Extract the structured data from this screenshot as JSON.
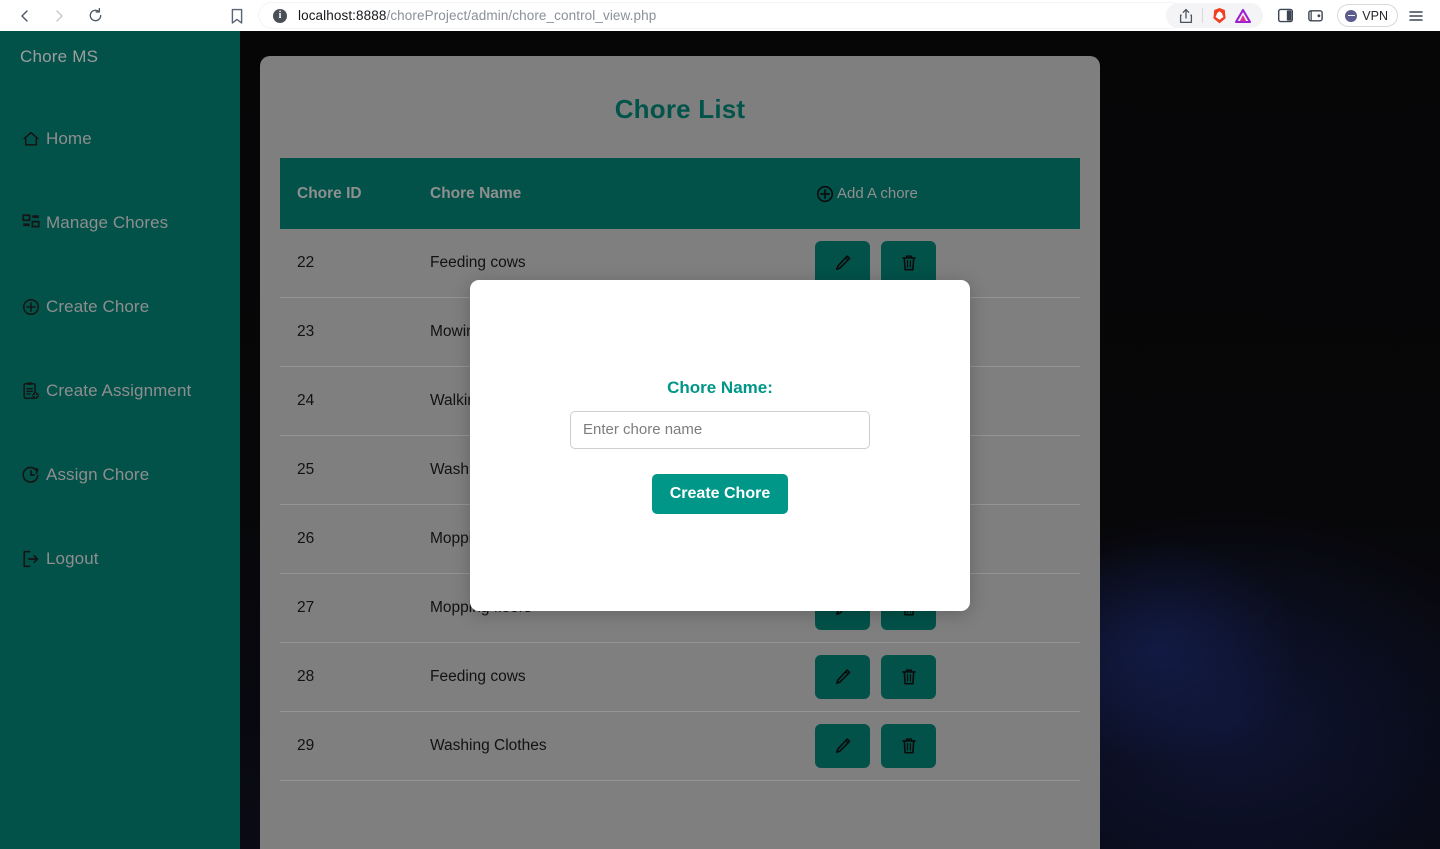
{
  "browser": {
    "back_icon": "chevron-left-icon",
    "forward_icon": "chevron-right-icon",
    "reload_icon": "reload-icon",
    "bookmark_icon": "bookmark-icon",
    "site_info_glyph": "i",
    "url_host": "localhost:8888",
    "url_path": "/choreProject/admin/chore_control_view.php",
    "share_icon": "share-icon",
    "brave_icon": "brave-lion-icon",
    "triangle_icon": "purple-triangle-icon",
    "sidebar_panel_icon": "sidebar-panel-icon",
    "wallet_icon": "wallet-icon",
    "vpn_label": "VPN",
    "menu_icon": "hamburger-menu-icon"
  },
  "sidebar": {
    "brand": "Chore MS",
    "bg_color": "#02524A",
    "text_color": "#8e8e8e",
    "items": [
      {
        "label": "Home",
        "icon": "home-icon"
      },
      {
        "label": "Manage Chores",
        "icon": "grid-dashboard-icon"
      },
      {
        "label": "Create Chore",
        "icon": "plus-circle-icon"
      },
      {
        "label": "Create Assignment",
        "icon": "clipboard-plus-icon"
      },
      {
        "label": "Assign Chore",
        "icon": "clock-arrow-icon"
      },
      {
        "label": "Logout",
        "icon": "logout-arrow-icon"
      }
    ]
  },
  "main": {
    "title": "Chore List",
    "title_color": "#02544A",
    "card_bg": "#7f7f7f",
    "table": {
      "headers": {
        "id": "Chore ID",
        "name": "Chore Name",
        "add_action": "Add A chore",
        "add_icon": "plus-circle-icon"
      },
      "rows": [
        {
          "id": "22",
          "name": "Feeding cows",
          "edit_icon": "pencil-icon",
          "delete_icon": "trash-icon"
        },
        {
          "id": "23",
          "name": "Mowing the lawn",
          "edit_icon": "pencil-icon",
          "delete_icon": "trash-icon"
        },
        {
          "id": "24",
          "name": "Walking the dog",
          "edit_icon": "pencil-icon",
          "delete_icon": "trash-icon"
        },
        {
          "id": "25",
          "name": "Washing dishes",
          "edit_icon": "pencil-icon",
          "delete_icon": "trash-icon"
        },
        {
          "id": "26",
          "name": "Mopping floors",
          "edit_icon": "pencil-icon",
          "delete_icon": "trash-icon"
        },
        {
          "id": "27",
          "name": "Mopping floors",
          "edit_icon": "pencil-icon",
          "delete_icon": "trash-icon"
        },
        {
          "id": "28",
          "name": "Feeding cows",
          "edit_icon": "pencil-icon",
          "delete_icon": "trash-icon"
        },
        {
          "id": "29",
          "name": "Washing Clothes",
          "edit_icon": "pencil-icon",
          "delete_icon": "trash-icon"
        }
      ]
    }
  },
  "modal": {
    "label": "Chore Name:",
    "input_value": "",
    "input_placeholder": "Enter chore name",
    "submit_label": "Create Chore",
    "accent_color": "#009688"
  }
}
